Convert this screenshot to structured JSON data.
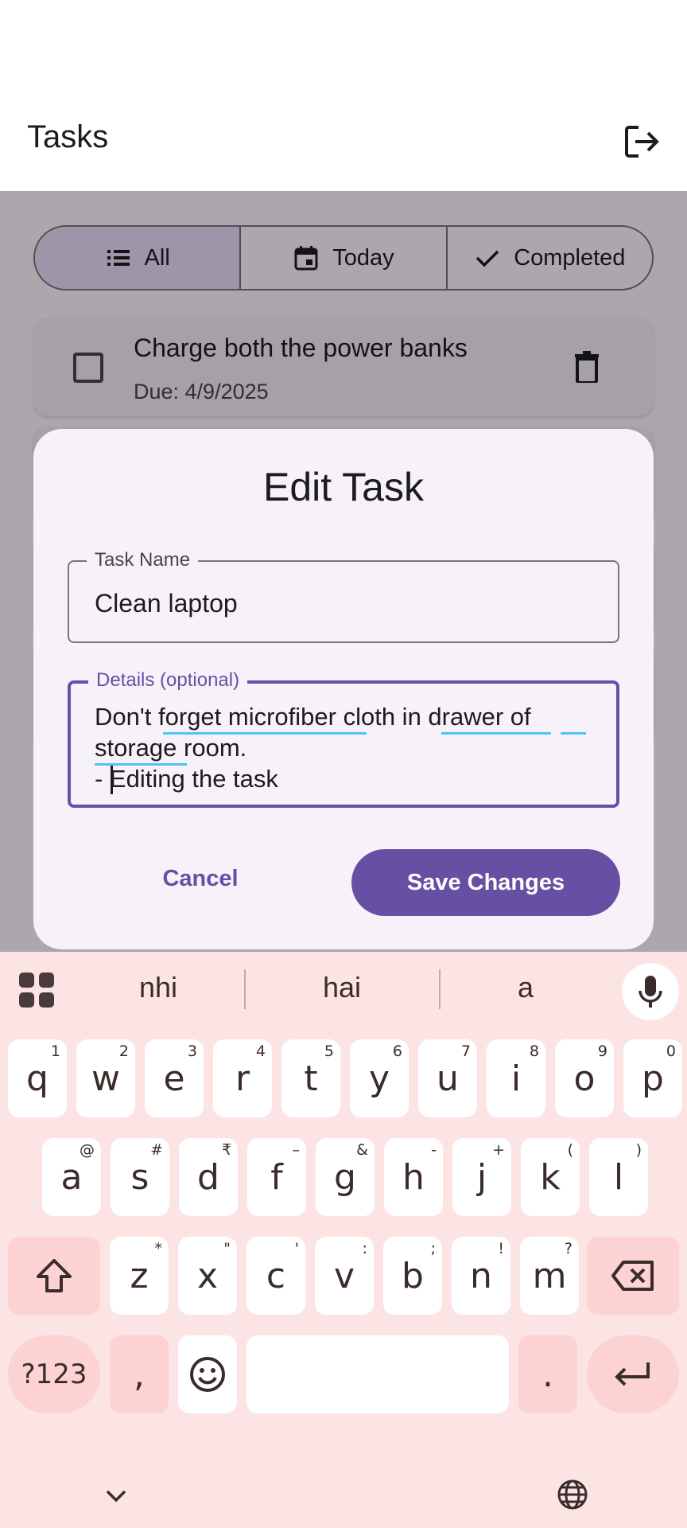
{
  "appbar": {
    "title": "Tasks"
  },
  "filters": {
    "all": "All",
    "today": "Today",
    "completed": "Completed",
    "selected": "All"
  },
  "task": {
    "title": "Charge both the power banks",
    "due": "Due: 4/9/2025"
  },
  "dialog": {
    "title": "Edit Task",
    "name_label": "Task Name",
    "name_value": "Clean laptop",
    "details_label": "Details (optional)",
    "details_value": "Don't forget microfiber cloth in drawer of storage room.\n- Editing the task",
    "cancel": "Cancel",
    "save": "Save Changes"
  },
  "keyboard": {
    "suggestions": [
      "nhi",
      "hai",
      "a"
    ],
    "row1": [
      {
        "k": "q",
        "s": "1"
      },
      {
        "k": "w",
        "s": "2"
      },
      {
        "k": "e",
        "s": "3"
      },
      {
        "k": "r",
        "s": "4"
      },
      {
        "k": "t",
        "s": "5"
      },
      {
        "k": "y",
        "s": "6"
      },
      {
        "k": "u",
        "s": "7"
      },
      {
        "k": "i",
        "s": "8"
      },
      {
        "k": "o",
        "s": "9"
      },
      {
        "k": "p",
        "s": "0"
      }
    ],
    "row2": [
      {
        "k": "a",
        "s": "@"
      },
      {
        "k": "s",
        "s": "#"
      },
      {
        "k": "d",
        "s": "₹"
      },
      {
        "k": "f",
        "s": "–"
      },
      {
        "k": "g",
        "s": "&"
      },
      {
        "k": "h",
        "s": "-"
      },
      {
        "k": "j",
        "s": "+"
      },
      {
        "k": "k",
        "s": "("
      },
      {
        "k": "l",
        "s": ")"
      }
    ],
    "row3": [
      {
        "k": "z",
        "s": "*"
      },
      {
        "k": "x",
        "s": "\""
      },
      {
        "k": "c",
        "s": "'"
      },
      {
        "k": "v",
        "s": ":"
      },
      {
        "k": "b",
        "s": ";"
      },
      {
        "k": "n",
        "s": "!"
      },
      {
        "k": "m",
        "s": "?"
      }
    ],
    "symbols_key": "?123",
    "comma_key": ",",
    "period_key": "."
  },
  "colors": {
    "primary": "#6750a4",
    "keyboard_bg": "#fde4e4",
    "function_key": "#fcd2d2"
  }
}
